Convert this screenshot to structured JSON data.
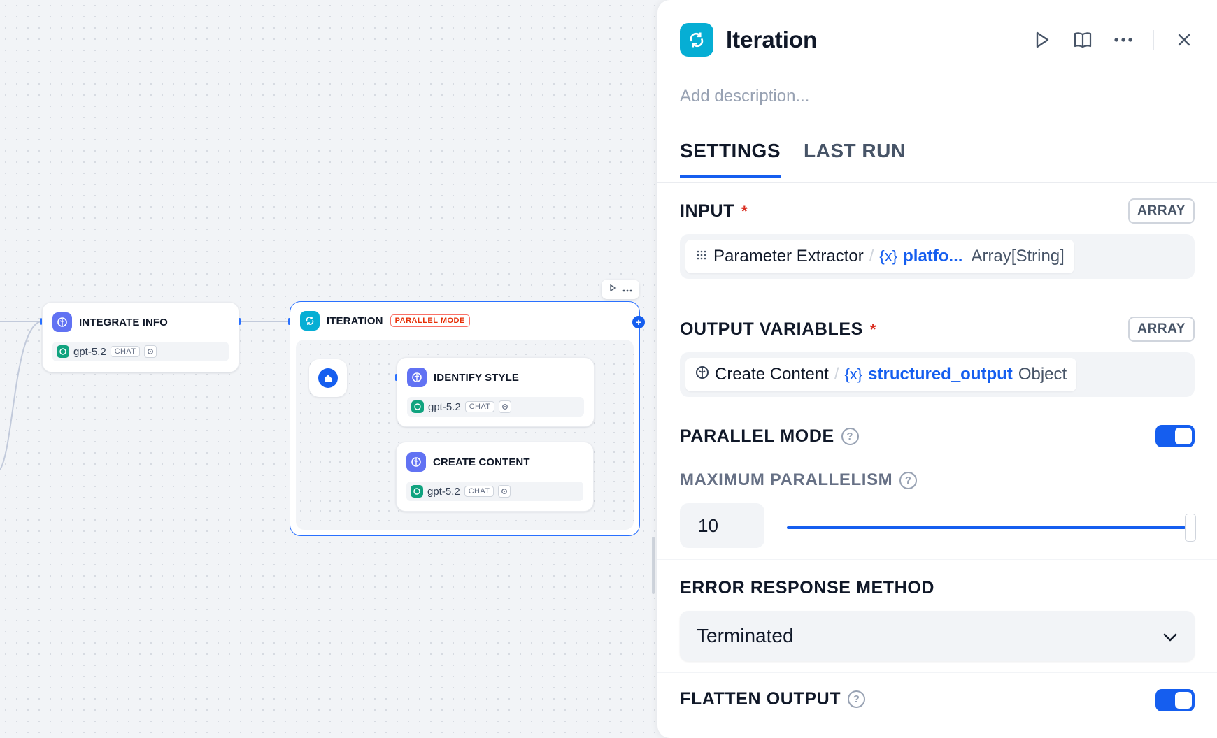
{
  "canvas": {
    "nodes": {
      "integrate_info": {
        "title": "INTEGRATE INFO",
        "model": "gpt-5.2",
        "mode_chip": "CHAT"
      },
      "iteration": {
        "title": "ITERATION",
        "badge": "PARALLEL MODE"
      },
      "identify_style": {
        "title": "IDENTIFY STYLE",
        "model": "gpt-5.2",
        "mode_chip": "CHAT"
      },
      "create_content": {
        "title": "CREATE CONTENT",
        "model": "gpt-5.2",
        "mode_chip": "CHAT"
      }
    },
    "icons": {
      "llm": "brain-icon",
      "iteration": "loop-icon",
      "start": "home-icon",
      "model": "openai-icon"
    }
  },
  "panel": {
    "title": "Iteration",
    "description_placeholder": "Add description...",
    "actions": [
      "play-icon",
      "book-icon",
      "more-icon",
      "close-icon"
    ],
    "tabs": [
      {
        "label": "SETTINGS",
        "active": true
      },
      {
        "label": "LAST RUN",
        "active": false
      }
    ],
    "input": {
      "label": "INPUT",
      "required_mark": "*",
      "type": "ARRAY",
      "variable": {
        "node": "Parameter Extractor",
        "separator": "/",
        "brace": "{x}",
        "name": "platfo...",
        "type": "Array[String]"
      }
    },
    "output": {
      "label": "OUTPUT VARIABLES",
      "required_mark": "*",
      "type": "ARRAY",
      "variable": {
        "node": "Create Content",
        "separator": "/",
        "brace": "{x}",
        "name": "structured_output",
        "type": "Object"
      }
    },
    "parallel_mode": {
      "label": "PARALLEL MODE",
      "help": "?",
      "enabled": true
    },
    "max_parallelism": {
      "label": "MAXIMUM PARALLELISM",
      "help": "?",
      "value": "10",
      "slider_fraction": 1.0
    },
    "error_response": {
      "label": "ERROR RESPONSE METHOD",
      "selected": "Terminated"
    },
    "flatten_output": {
      "label": "FLATTEN OUTPUT",
      "help": "?",
      "enabled": true
    },
    "accent_color": "#155eef",
    "iteration_color": "#06aed4"
  }
}
